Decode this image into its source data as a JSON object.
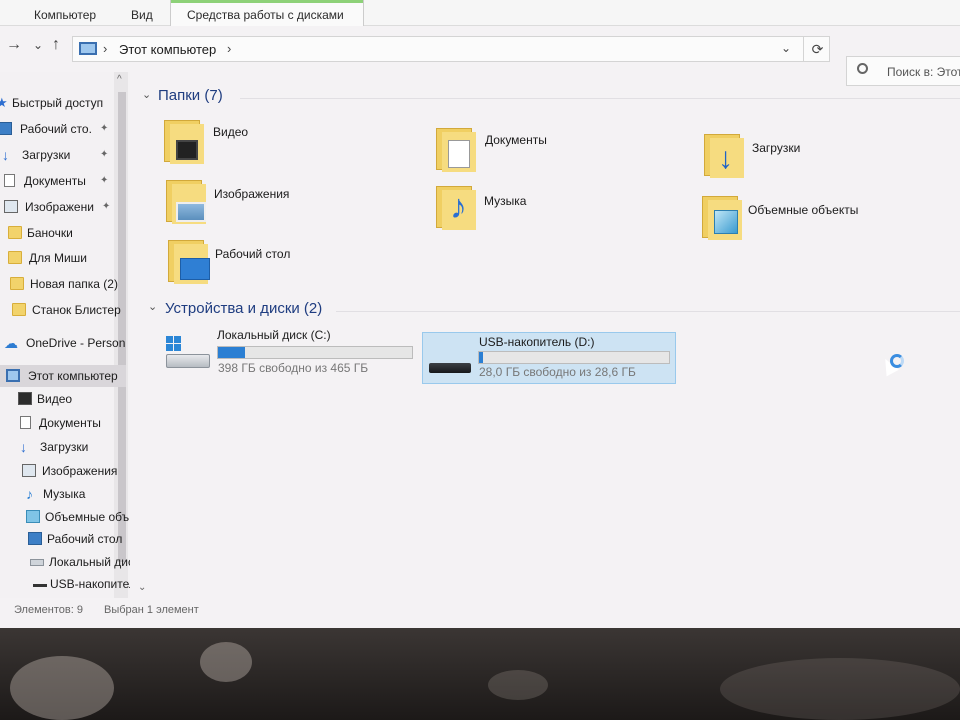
{
  "ribbon": {
    "tabs": [
      {
        "label": "Компьютер"
      },
      {
        "label": "Вид"
      },
      {
        "label": "Средства работы с дисками"
      }
    ]
  },
  "address": {
    "path": "Этот компьютер",
    "separator": "›",
    "dropdown": "⌄",
    "refresh": "⟳"
  },
  "nav": {
    "forward": "→",
    "recent": "⌄",
    "up": "↑"
  },
  "search": {
    "placeholder": "Поиск в: Этот"
  },
  "sidebar": {
    "items": [
      {
        "label": "Быстрый доступ",
        "icon": "star-icon"
      },
      {
        "label": "Рабочий сто.",
        "icon": "desktop-icon",
        "pinned": true
      },
      {
        "label": "Загрузки",
        "icon": "download-icon",
        "pinned": true
      },
      {
        "label": "Документы",
        "icon": "documents-icon",
        "pinned": true
      },
      {
        "label": "Изображени",
        "icon": "pictures-icon",
        "pinned": true
      },
      {
        "label": "Баночки",
        "icon": "folder-icon"
      },
      {
        "label": "Для Миши",
        "icon": "folder-icon"
      },
      {
        "label": "Новая папка (2)",
        "icon": "folder-icon"
      },
      {
        "label": "Станок Блистер",
        "icon": "folder-icon"
      },
      {
        "label": "OneDrive - Person",
        "icon": "cloud-icon"
      },
      {
        "label": "Этот компьютер",
        "icon": "pc-icon",
        "selected": true
      },
      {
        "label": "Видео",
        "icon": "video-icon"
      },
      {
        "label": "Документы",
        "icon": "documents-icon"
      },
      {
        "label": "Загрузки",
        "icon": "download-icon"
      },
      {
        "label": "Изображения",
        "icon": "pictures-icon"
      },
      {
        "label": "Музыка",
        "icon": "music-icon"
      },
      {
        "label": "Объемные объ",
        "icon": "3d-objects-icon"
      },
      {
        "label": "Рабочий стол",
        "icon": "desktop-icon"
      },
      {
        "label": "Локальный дис",
        "icon": "drive-icon"
      },
      {
        "label": "USB-накопител",
        "icon": "usb-icon"
      }
    ],
    "pin_glyph": "📌"
  },
  "folders_group": {
    "title": "Папки (7)",
    "items": [
      {
        "label": "Видео",
        "icon": "video-folder-icon"
      },
      {
        "label": "Документы",
        "icon": "documents-folder-icon"
      },
      {
        "label": "Загрузки",
        "icon": "downloads-folder-icon"
      },
      {
        "label": "Изображения",
        "icon": "pictures-folder-icon"
      },
      {
        "label": "Музыка",
        "icon": "music-folder-icon"
      },
      {
        "label": "Объемные объекты",
        "icon": "3d-objects-folder-icon"
      },
      {
        "label": "Рабочий стол",
        "icon": "desktop-folder-icon"
      }
    ]
  },
  "drives_group": {
    "title": "Устройства и диски (2)",
    "items": [
      {
        "label": "Локальный диск (C:)",
        "free": "398 ГБ свободно из 465 ГБ",
        "used_fraction": 0.14,
        "icon": "local-disk-icon"
      },
      {
        "label": "USB-накопитель (D:)",
        "free": "28,0 ГБ свободно из 28,6 ГБ",
        "used_fraction": 0.02,
        "icon": "usb-drive-icon",
        "selected": true
      }
    ]
  },
  "status": {
    "items_count": "Элементов: 9",
    "selected": "Выбран 1 элемент"
  },
  "colors": {
    "accent": "#2b7fd3",
    "header": "#1f3d80",
    "selection": "#cde3f3"
  }
}
